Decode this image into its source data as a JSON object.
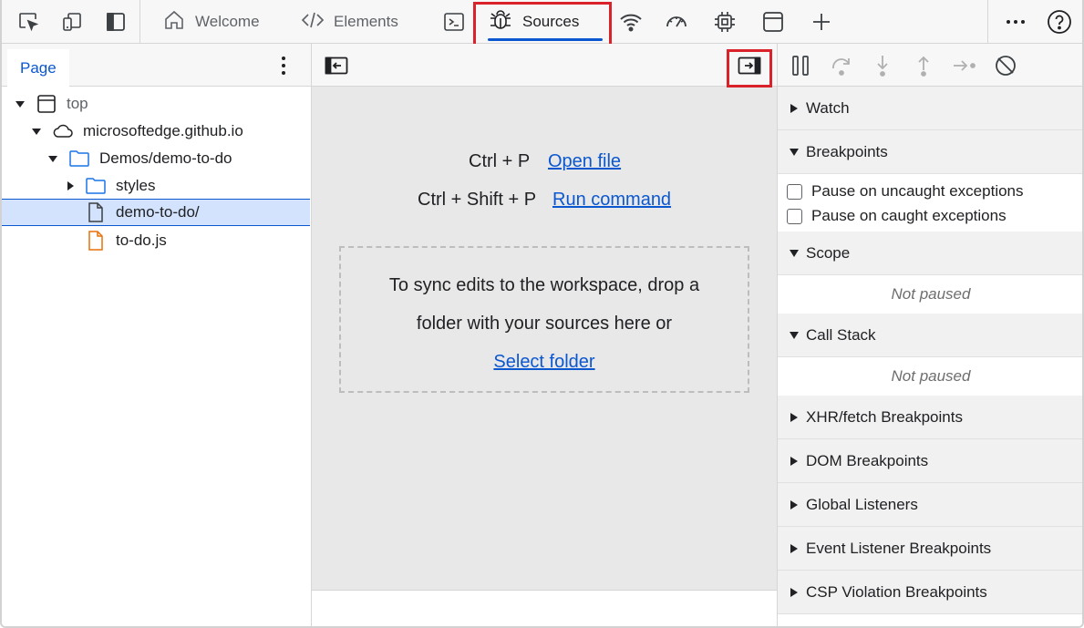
{
  "toolbar": {
    "tabs": [
      {
        "label": "Welcome",
        "icon": "home-icon"
      },
      {
        "label": "Elements",
        "icon": "code-icon"
      },
      {
        "label": "Sources",
        "icon": "bug-icon",
        "active": true
      }
    ],
    "more_icon": "more-horizontal-icon",
    "help_icon": "help-icon",
    "accent_color": "#0b57d0",
    "highlight_color": "#d9222a"
  },
  "navigator": {
    "tab_label": "Page",
    "tree": [
      {
        "label": "top",
        "icon": "frame-icon",
        "expanded": true
      },
      {
        "label": "microsoftedge.github.io",
        "icon": "cloud-icon",
        "expanded": true
      },
      {
        "label": "Demos/demo-to-do",
        "icon": "folder-icon",
        "expanded": true
      },
      {
        "label": "styles",
        "icon": "folder-icon",
        "expanded": false
      },
      {
        "label": "demo-to-do/",
        "icon": "file-icon",
        "selected": true
      },
      {
        "label": "to-do.js",
        "icon": "js-file-icon"
      }
    ]
  },
  "editor": {
    "shortcuts": [
      {
        "keys": "Ctrl + P",
        "action": "Open file"
      },
      {
        "keys": "Ctrl + Shift + P",
        "action": "Run command"
      }
    ],
    "dropzone": {
      "line1": "To sync edits to the workspace, drop a",
      "line2": "folder with your sources here or",
      "link": "Select folder"
    }
  },
  "debugger": {
    "sections": {
      "watch": "Watch",
      "breakpoints": "Breakpoints",
      "scope": "Scope",
      "call_stack": "Call Stack",
      "xhr": "XHR/fetch Breakpoints",
      "dom": "DOM Breakpoints",
      "global": "Global Listeners",
      "event": "Event Listener Breakpoints",
      "csp": "CSP Violation Breakpoints"
    },
    "pause_uncaught": "Pause on uncaught exceptions",
    "pause_caught": "Pause on caught exceptions",
    "scope_status": "Not paused",
    "callstack_status": "Not paused"
  }
}
